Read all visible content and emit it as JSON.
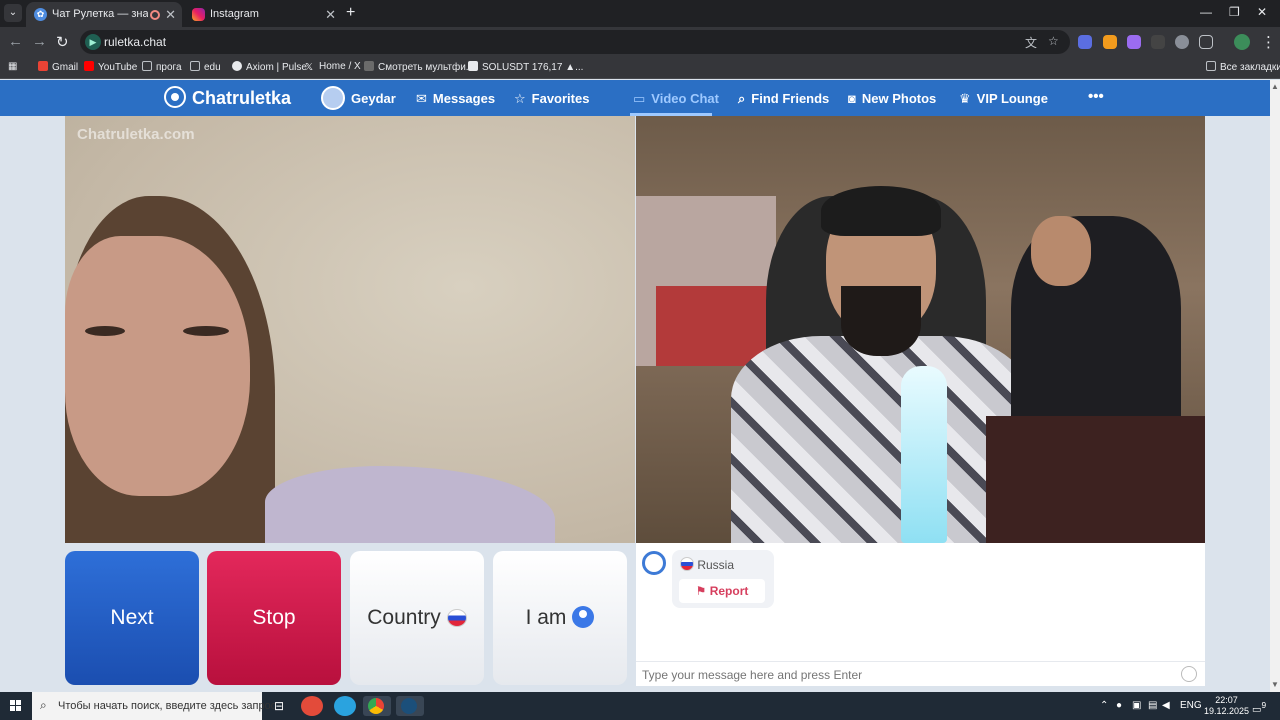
{
  "browser": {
    "tabs": [
      {
        "title": "Чат Рулетка — знакомства",
        "active": true
      },
      {
        "title": "Instagram",
        "active": false
      }
    ],
    "url": "ruletka.chat",
    "bookmarks": [
      "Gmail",
      "YouTube",
      "прога",
      "edu",
      "Axiom | Pulse",
      "Home / X",
      "Смотреть мультфи...",
      "SOLUSDT 176,17 ▲..."
    ],
    "all_bookmarks_label": "Все закладки"
  },
  "site": {
    "logo": "Chatruletka",
    "nav": [
      {
        "label": "Geydar",
        "icon": "avatar"
      },
      {
        "label": "Messages",
        "icon": "mail-icon"
      },
      {
        "label": "Favorites",
        "icon": "star-icon"
      },
      {
        "label": "Video Chat",
        "icon": "video-icon",
        "active": true
      },
      {
        "label": "Find Friends",
        "icon": "search-icon"
      },
      {
        "label": "New Photos",
        "icon": "camera-icon"
      },
      {
        "label": "VIP Lounge",
        "icon": "crown-icon"
      }
    ],
    "more_label": "•••",
    "watermark": "Chatruletka.com"
  },
  "controls": {
    "next": "Next",
    "stop": "Stop",
    "country": "Country",
    "iam": "I am"
  },
  "chat": {
    "partner_country": "Russia",
    "report": "Report",
    "input_placeholder": "Type your message here and press Enter"
  },
  "taskbar": {
    "search_placeholder": "Чтобы начать поиск, введите здесь запрос",
    "lang": "ENG",
    "time": "22:07",
    "date": "19.12.2025",
    "notifications": "9"
  },
  "colors": {
    "nav_blue": "#2b6fc4",
    "next_blue": "#2e6fd8",
    "stop_red": "#e3285b",
    "report_red": "#d63f5e"
  }
}
